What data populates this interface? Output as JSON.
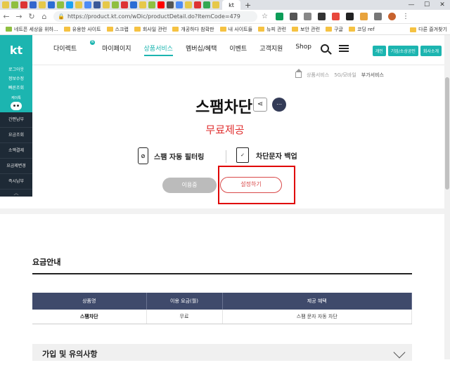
{
  "browser": {
    "url": "https://product.kt.com/wDic/productDetail.do?ItemCode=479",
    "active_tab_label": "kt",
    "bookmarks": [
      "네트픈 세상을 위하...",
      "유용한 사이트",
      "스크랩",
      "회사일 관련",
      "개공하다 참확판",
      "내 사이트들",
      "뉴피 관련",
      "보안 관련",
      "구글",
      "코딩 ref"
    ],
    "other_bookmarks": "다른 즐겨찾기"
  },
  "sidebar": {
    "logo": "kt",
    "top_items": [
      "로그아웃",
      "정보수정",
      "빠른조회"
    ],
    "chatbot_label": "케이톡",
    "dark_items": [
      "간편납부",
      "요금조회",
      "소액결제",
      "요금제변경",
      "즉시납부"
    ]
  },
  "gnb": {
    "menu": [
      "다이렉트",
      "마이페이지",
      "상품서비스",
      "멤버십/혜택",
      "이벤트",
      "고객지원",
      "Shop"
    ],
    "active_menu": "상품서비스",
    "segments": [
      "개인",
      "기업/소상공인",
      "회사소개"
    ]
  },
  "breadcrumb": [
    "상품서비스",
    "5G/모바일",
    "부가서비스"
  ],
  "product": {
    "title": "스팸차단",
    "price": "무료제공",
    "features": [
      "스팸 자동 필터링",
      "차단문자 백업"
    ],
    "status_button": "이용중",
    "setting_button": "설정하기"
  },
  "fee_section": {
    "title": "요금안내",
    "headers": [
      "상품명",
      "이용 요금(월)",
      "제공 혜택"
    ],
    "row": [
      "스팸차단",
      "무료",
      "스팸 문자 자동 차단"
    ]
  },
  "accordion": {
    "title": "가입 및 유의사항"
  },
  "colors": {
    "brand": "#1cb5b0",
    "price": "#e03030",
    "table_header": "#3f4a6b",
    "highlight": "#e00000"
  }
}
